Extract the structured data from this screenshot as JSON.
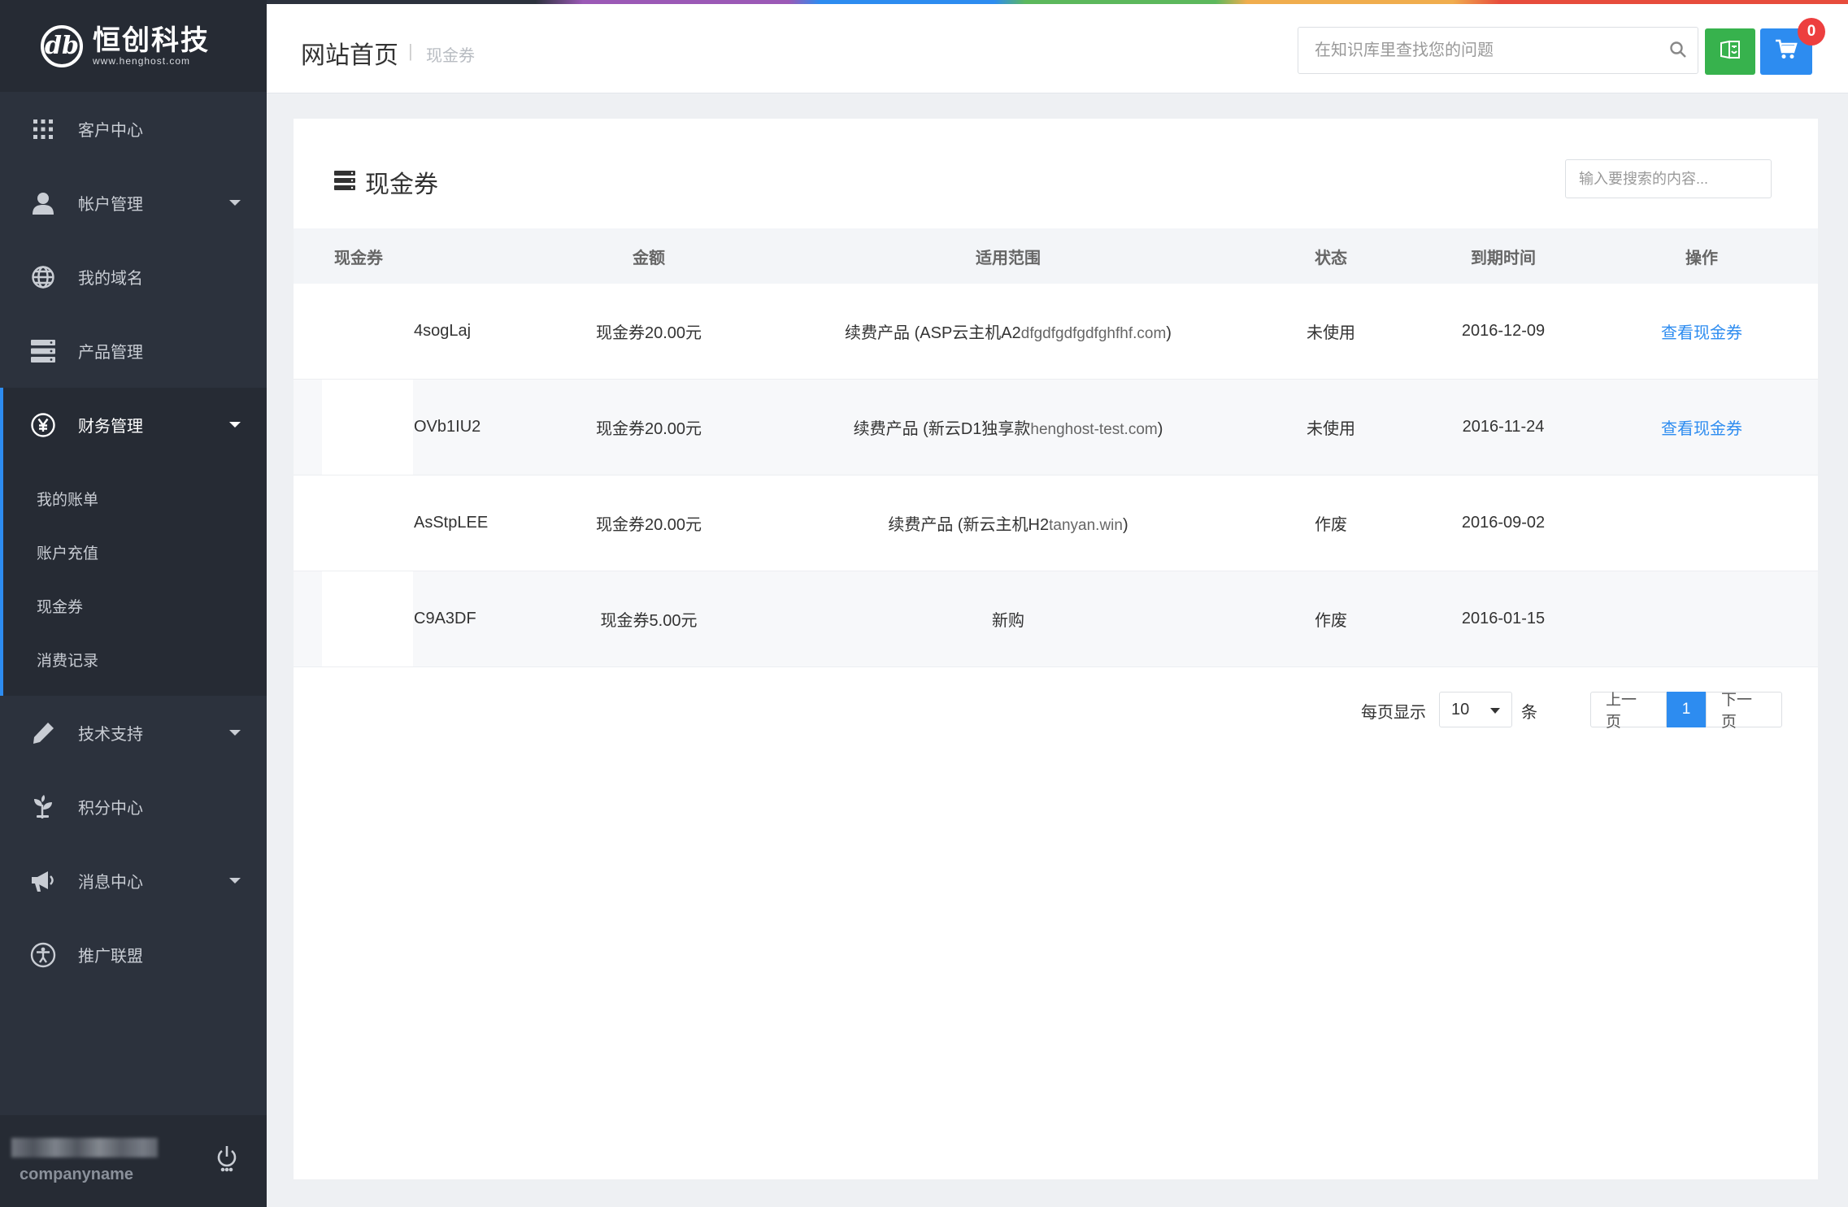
{
  "brand": {
    "logo_glyph": "db",
    "name_cn": "恒创科技",
    "name_en": "www.henghost.com"
  },
  "sidebar": {
    "items": [
      {
        "label": "客户中心",
        "icon": "grid-icon"
      },
      {
        "label": "帐户管理",
        "icon": "user-icon",
        "caret": true
      },
      {
        "label": "我的域名",
        "icon": "globe-icon"
      },
      {
        "label": "产品管理",
        "icon": "server-icon"
      },
      {
        "label": "财务管理",
        "icon": "yen-icon",
        "caret": true,
        "active": true
      },
      {
        "label": "技术支持",
        "icon": "pencil-icon",
        "caret": true
      },
      {
        "label": "积分中心",
        "icon": "leaf-icon"
      },
      {
        "label": "消息中心",
        "icon": "megaphone-icon",
        "caret": true
      },
      {
        "label": "推广联盟",
        "icon": "accessibility-icon"
      }
    ],
    "finance_sub": [
      "我的账单",
      "账户充值",
      "现金券",
      "消费记录"
    ],
    "footer": {
      "company": "companyname",
      "power_icon": "power-icon"
    }
  },
  "header": {
    "title": "网站首页",
    "separator": "|",
    "breadcrumb": "现金券",
    "search_placeholder": "在知识库里查找您的问题",
    "cart_count": "0",
    "colors": {
      "green": "#37b24d",
      "blue": "#2d8cf0",
      "badge": "#ed3f3f"
    }
  },
  "main": {
    "title": "现金券",
    "search_placeholder": "输入要搜索的内容...",
    "columns": [
      "现金券",
      "金额",
      "适用范围",
      "状态",
      "到期时间",
      "操作"
    ],
    "rows": [
      {
        "code": "4sogLaj",
        "amount": "现金券20.00元",
        "scope": "续费产品 (ASP云主机A2",
        "scope_domain": "dfgdfgdfgdfghfhf.com",
        "scope_end": ")",
        "status": "未使用",
        "expires": "2016-12-09",
        "action": "查看现金券"
      },
      {
        "code": "OVb1IU2",
        "amount": "现金券20.00元",
        "scope": "续费产品 (新云D1独享款",
        "scope_domain": "henghost-test.com",
        "scope_end": ")",
        "status": "未使用",
        "expires": "2016-11-24",
        "action": "查看现金券"
      },
      {
        "code": "AsStpLEE",
        "amount": "现金券20.00元",
        "scope": "续费产品 (新云主机H2",
        "scope_domain": "tanyan.win",
        "scope_end": ")",
        "status": "作废",
        "expires": "2016-09-02",
        "action": ""
      },
      {
        "code": "C9A3DF",
        "amount": "现金券5.00元",
        "scope": "新购",
        "scope_domain": "",
        "scope_end": "",
        "status": "作废",
        "expires": "2016-01-15",
        "action": ""
      }
    ],
    "pagination": {
      "per_page_label": "每页显示",
      "per_page_value": "10",
      "per_page_unit": "条",
      "prev": "上一页",
      "current": "1",
      "next": "下一页"
    }
  }
}
